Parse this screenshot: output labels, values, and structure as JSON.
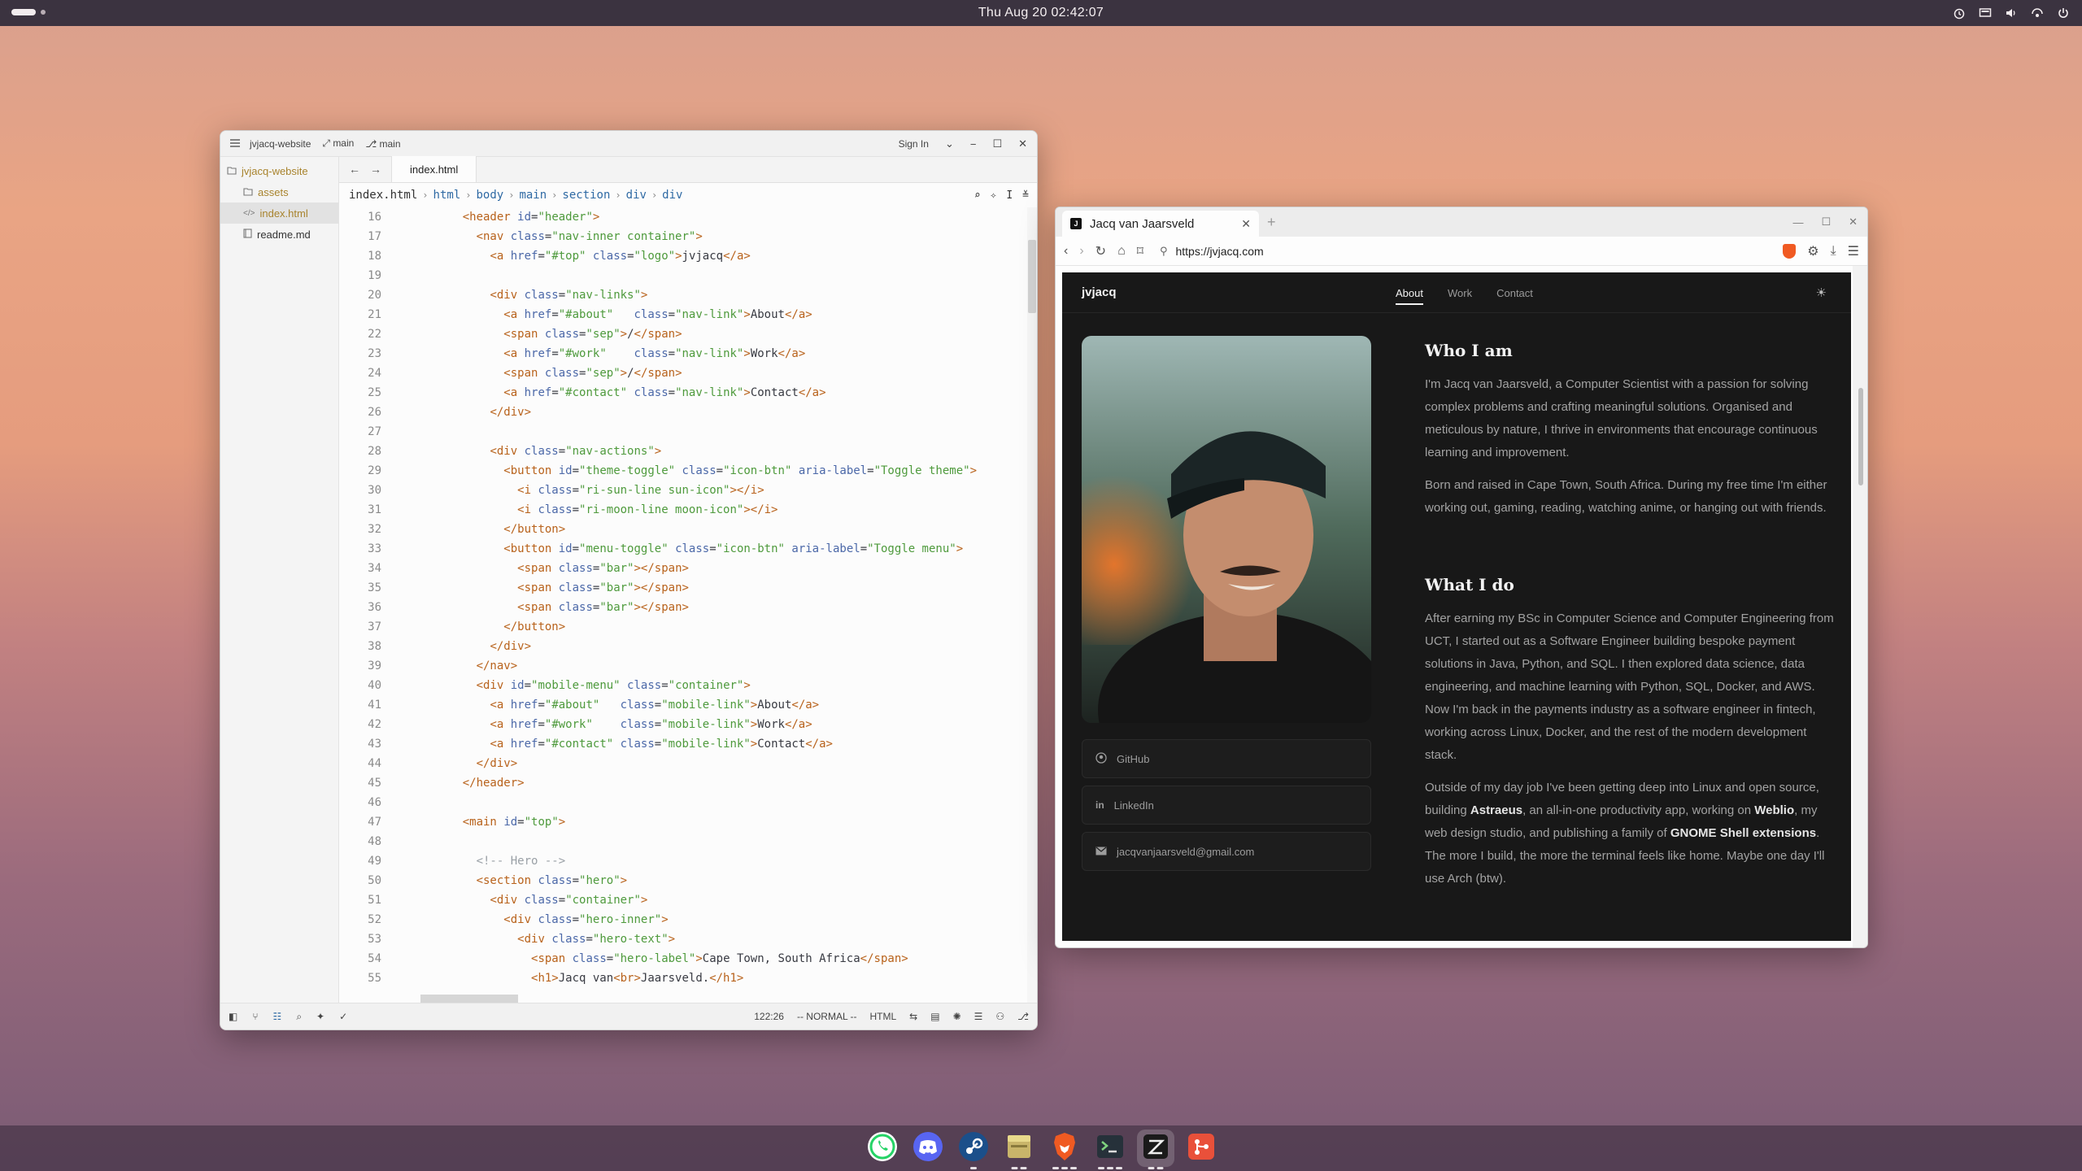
{
  "topbar": {
    "clock": "Thu Aug 20  02:42:07"
  },
  "editor": {
    "project": "jvjacq-website",
    "branch_label": "main",
    "branch2_label": "main",
    "sign_in": "Sign In",
    "sidebar": {
      "root": "jvjacq-website",
      "items": [
        {
          "label": "assets",
          "icon": "folder-icon"
        },
        {
          "label": "index.html",
          "icon": "code-file-icon"
        },
        {
          "label": "readme.md",
          "icon": "book-icon"
        }
      ]
    },
    "active_tab": "index.html",
    "breadcrumb": [
      "index.html",
      "html",
      "body",
      "main",
      "section",
      "div",
      "div"
    ],
    "status": {
      "position": "122:26",
      "mode": "-- NORMAL --",
      "language": "HTML"
    }
  },
  "browser": {
    "tab_title": "Jacq van Jaarsveld",
    "url": "https://jvjacq.com",
    "site": {
      "logo": "jvjacq",
      "nav": [
        "About",
        "Work",
        "Contact"
      ],
      "socials": [
        {
          "label": "GitHub",
          "icon": "github-icon"
        },
        {
          "label": "LinkedIn",
          "icon": "linkedin-icon"
        },
        {
          "label": "jacqvanjaarsveld@gmail.com",
          "icon": "mail-icon"
        }
      ],
      "who_title": "Who I am",
      "who_p1": "I'm Jacq van Jaarsveld, a Computer Scientist with a passion for solving complex problems and crafting meaningful solutions. Organised and meticulous by nature, I thrive in environments that encourage continuous learning and improvement.",
      "who_p2": "Born and raised in Cape Town, South Africa. During my free time I'm either working out, gaming, reading, watching anime, or hanging out with friends.",
      "what_title": "What I do",
      "what_p1": "After earning my BSc in Computer Science and Computer Engineering from UCT, I started out as a Software Engineer building bespoke payment solutions in Java, Python, and SQL. I then explored data science, data engineering, and machine learning with Python, SQL, Docker, and AWS. Now I'm back in the payments industry as a software engineer in fintech, working across Linux, Docker, and the rest of the modern development stack.",
      "what_p2_a": "Outside of my day job I've been getting deep into Linux and open source, building ",
      "what_p2_b": "Astraeus",
      "what_p2_c": ", an all-in-one productivity app, working on ",
      "what_p2_d": "Weblio",
      "what_p2_e": ", my web design studio, and publishing a family of ",
      "what_p2_f": "GNOME Shell extensions",
      "what_p2_g": ". The more I build, the more the terminal feels like home. Maybe one day I'll use Arch (btw)."
    }
  },
  "dock": [
    "whatsapp-icon",
    "discord-icon",
    "steam-icon",
    "files-icon",
    "brave-icon",
    "terminal-icon",
    "zed-icon",
    "git-icon"
  ]
}
